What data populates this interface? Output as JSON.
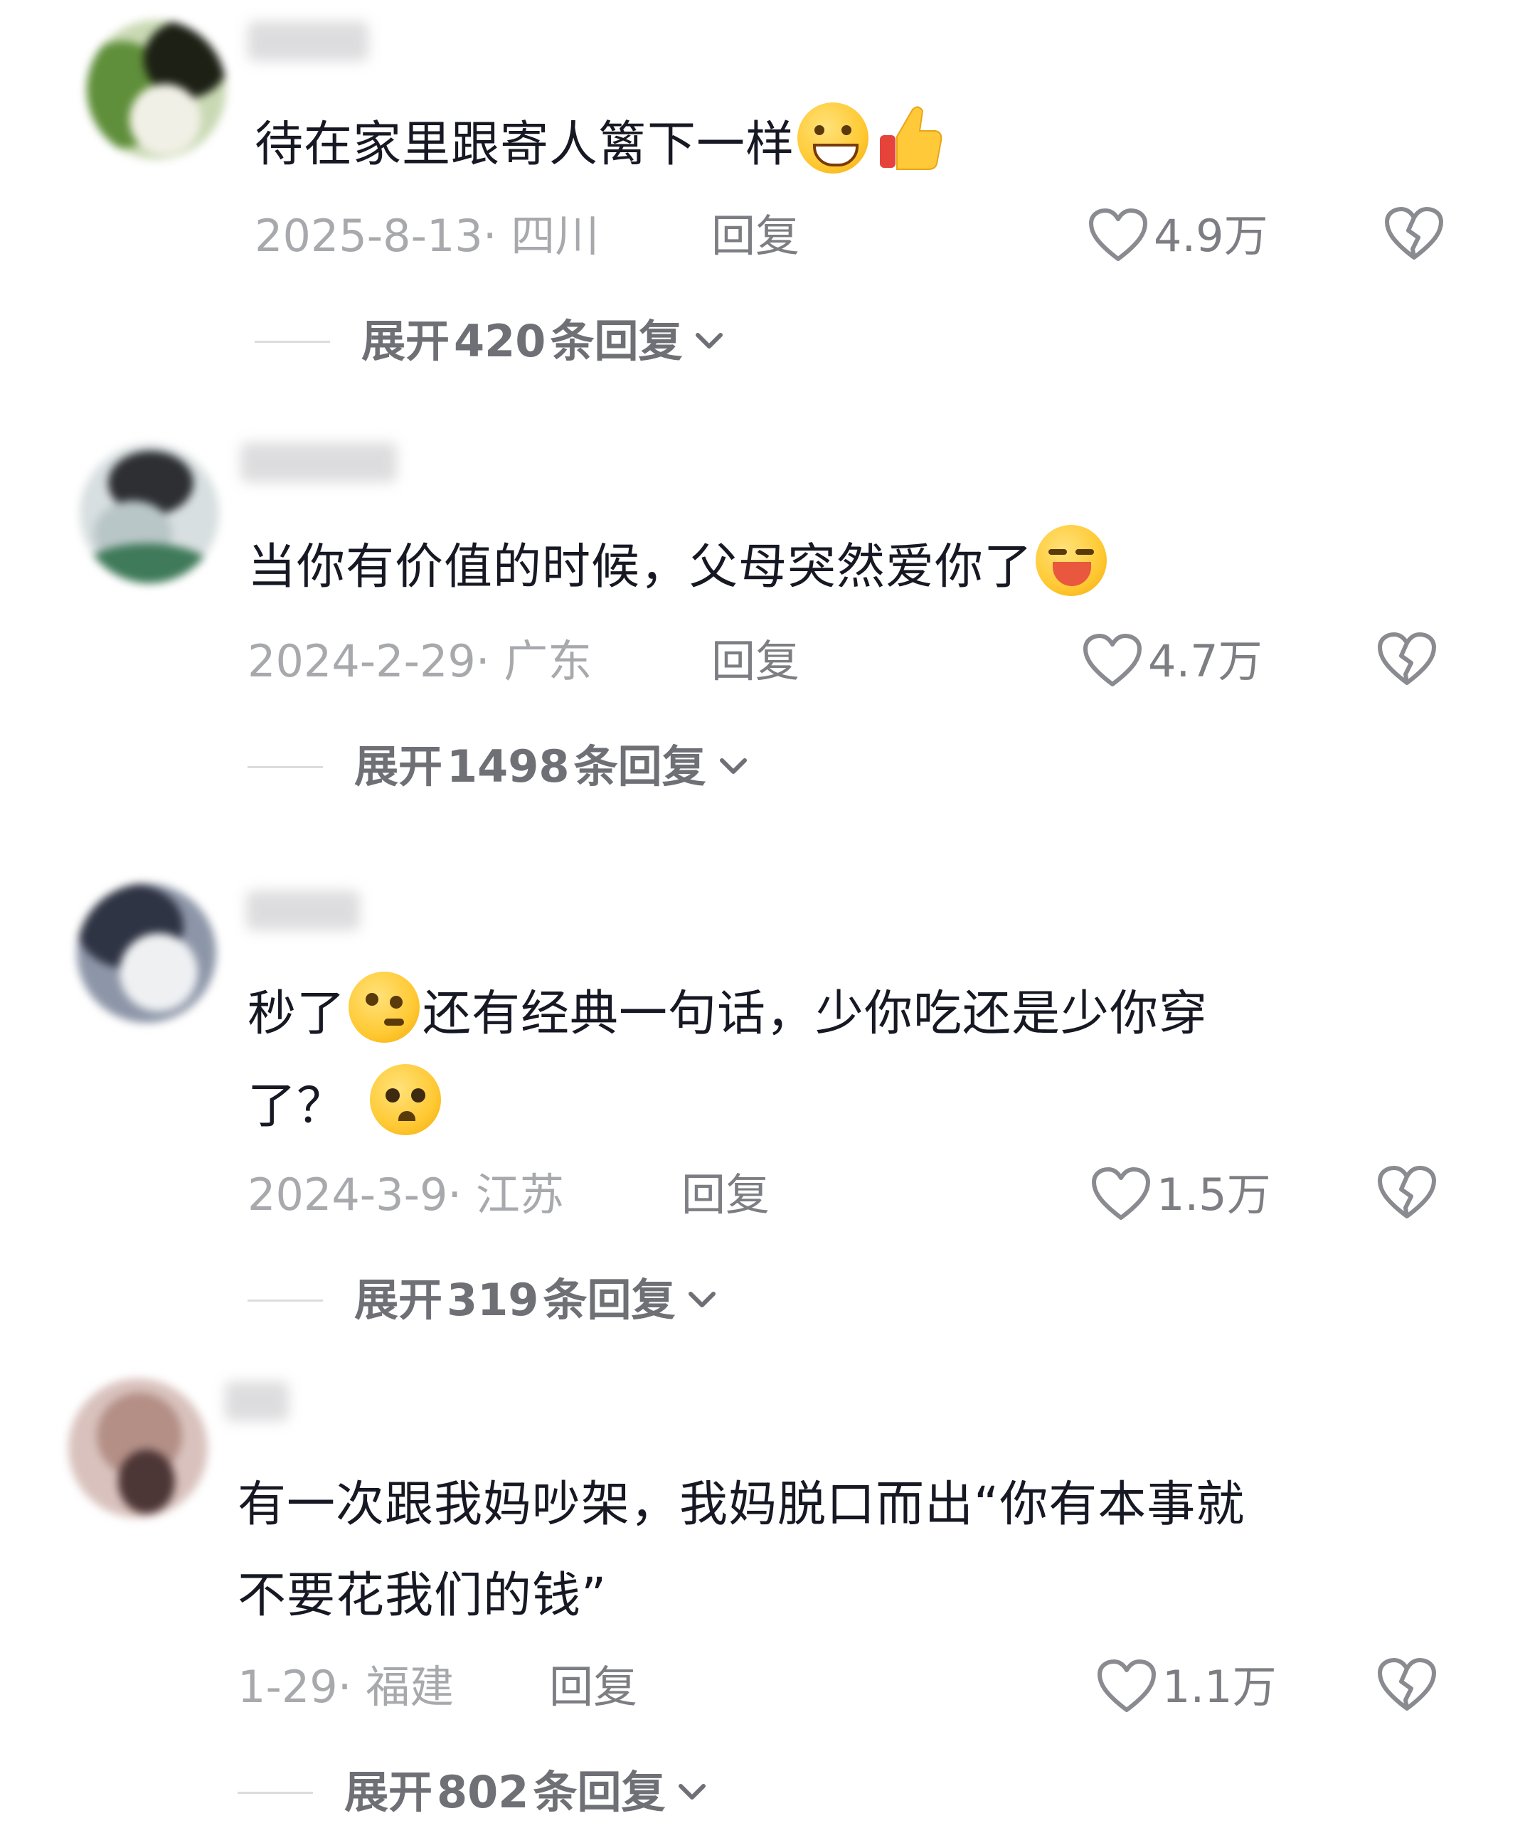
{
  "comments": [
    {
      "text": "待在家里跟寄人篱下一样",
      "emojis": [
        "grin-emoji",
        "thumbs-up-emoji"
      ],
      "date_location": "2025-8-13· 四川",
      "reply_label": "回复",
      "likes": "4.9万",
      "expand_prefix": "展开",
      "expand_count": "420",
      "expand_suffix": "条回复"
    },
    {
      "text": "当你有价值的时候，父母突然爱你了",
      "emojis": [
        "laugh-cry-emoji"
      ],
      "date_location": "2024-2-29· 广东",
      "reply_label": "回复",
      "likes": "4.7万",
      "expand_prefix": "展开",
      "expand_count": "1498",
      "expand_suffix": "条回复"
    },
    {
      "text_part1": "秒了",
      "text_part2": "还有经典一句话，少你吃还是少你穿",
      "text_line2": "了？",
      "emojis": [
        "thinking-emoji",
        "pleading-emoji"
      ],
      "date_location": "2024-3-9· 江苏",
      "reply_label": "回复",
      "likes": "1.5万",
      "expand_prefix": "展开",
      "expand_count": "319",
      "expand_suffix": "条回复"
    },
    {
      "text_line1": "有一次跟我妈吵架，我妈脱口而出“你有本事就",
      "text_line2": "不要花我们的钱”",
      "date_location": "1-29· 福建",
      "reply_label": "回复",
      "likes": "1.1万",
      "expand_prefix": "展开",
      "expand_count": "802",
      "expand_suffix": "条回复"
    }
  ],
  "icons": {
    "like": "heart-outline-icon",
    "dislike": "broken-heart-icon",
    "expand": "chevron-down-icon"
  },
  "colors": {
    "text_primary": "#161823",
    "text_meta": "#a8a9ad",
    "text_secondary": "#7d7e83"
  }
}
